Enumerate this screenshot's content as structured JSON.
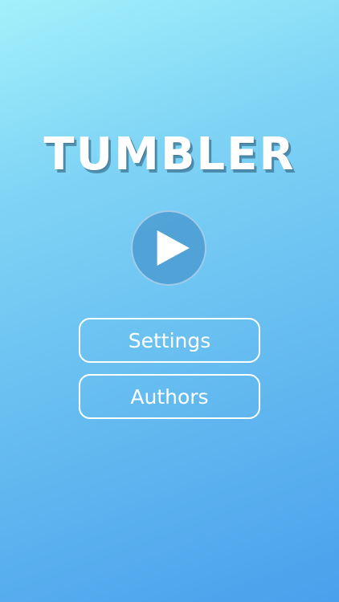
{
  "app": {
    "title": "TUMBLER"
  },
  "menu": {
    "play_icon": "play-icon",
    "settings_label": "Settings",
    "authors_label": "Authors"
  },
  "colors": {
    "gradient_top": "#a2f1fb",
    "gradient_bottom": "#4aa0ec",
    "play_circle": "#4696cd",
    "text": "#ffffff"
  }
}
